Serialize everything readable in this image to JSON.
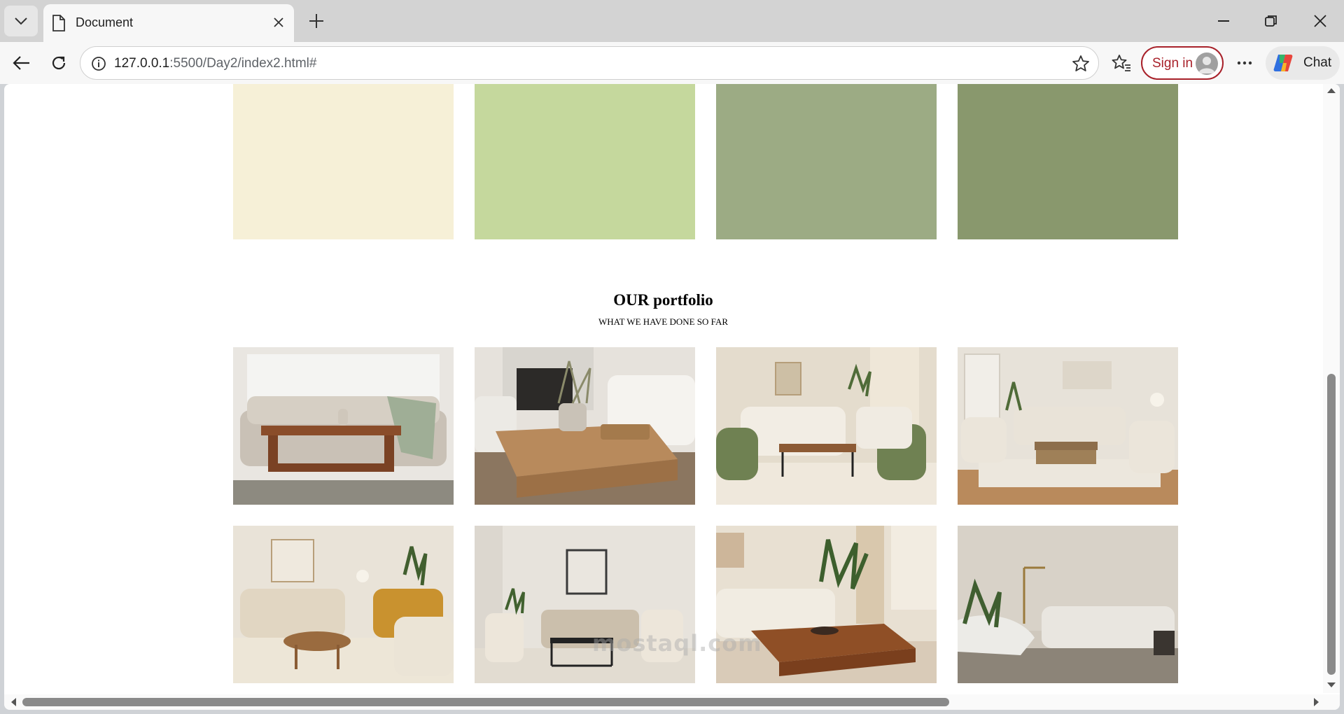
{
  "browser": {
    "tab": {
      "title": "Document",
      "icon": "document-icon"
    },
    "address": {
      "host": "127.0.0.1",
      "path": ":5500/Day2/index2.html#"
    },
    "signin_label": "Sign in",
    "chat_label": "Chat"
  },
  "page": {
    "swatches": [
      {
        "color": "#f6f0d7"
      },
      {
        "color": "#c5d89d"
      },
      {
        "color": "#9cab84"
      },
      {
        "color": "#89986d"
      }
    ],
    "portfolio": {
      "title": "OUR portfolio",
      "subtitle": "WHAT WE HAVE DONE SO FAR",
      "images": [
        {
          "subject": "sofa with wooden coffee table"
        },
        {
          "subject": "living room with fireplace and wooden table"
        },
        {
          "subject": "beige sofa with green armchairs"
        },
        {
          "subject": "beige living room set"
        },
        {
          "subject": "beige sofa with mustard armchair"
        },
        {
          "subject": "minimal living room with framed art"
        },
        {
          "subject": "sofa with plant and walnut table"
        },
        {
          "subject": "curved lounge chair and sofa"
        }
      ]
    },
    "watermark": "mostaql.com"
  }
}
